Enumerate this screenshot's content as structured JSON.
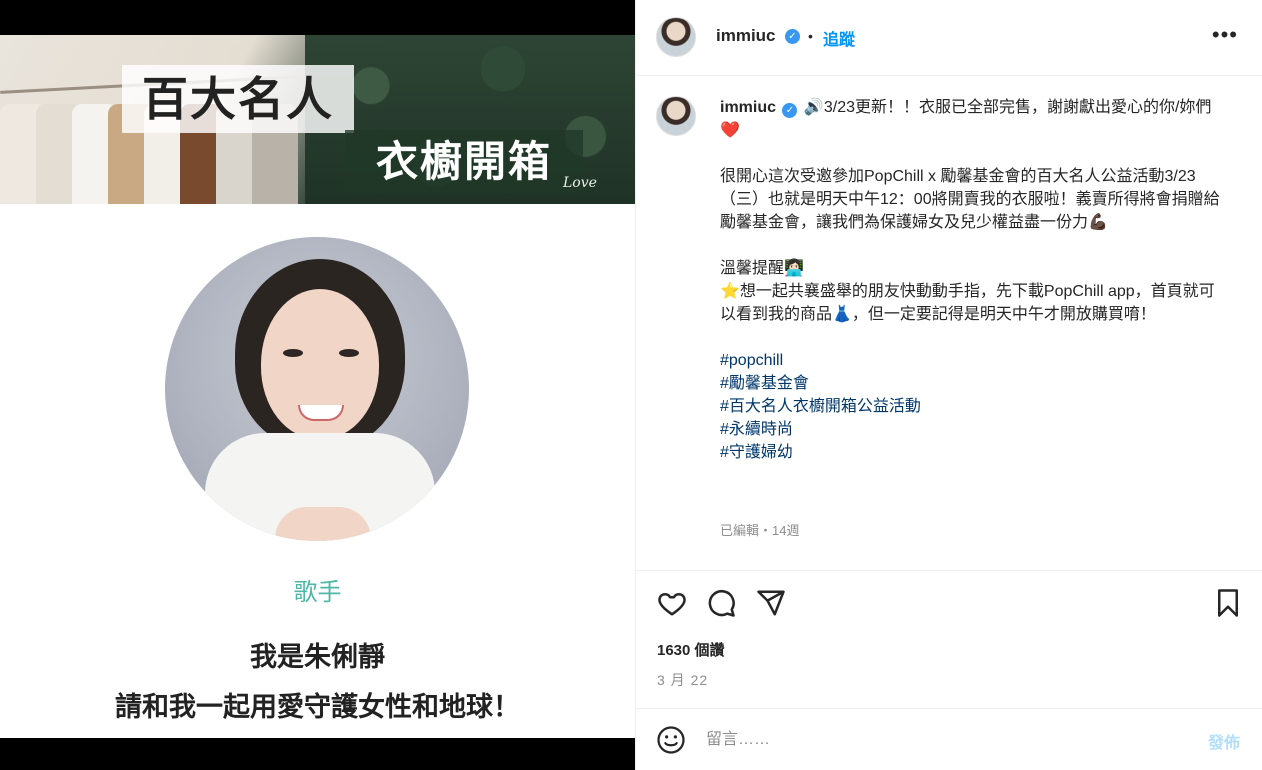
{
  "media": {
    "banner_title_1": "百大名人",
    "banner_title_2": "衣櫥開箱",
    "banner_signature": "Love",
    "role": "歌手",
    "line1": "我是朱俐靜",
    "line2": "請和我一起用愛守護女性和地球！"
  },
  "header": {
    "username": "immiuc",
    "separator": "•",
    "follow_label": "追蹤",
    "more_label": "•••"
  },
  "caption": {
    "username": "immiuc",
    "line_1": "🔊3/23更新！！衣服已全部完售，謝謝獻出愛心的你/妳們❤️",
    "paragraph_2": "很開心這次受邀參加PopChill x 勵馨基金會的百大名人公益活動3/23（三）也就是明天中午12：00將開賣我的衣服啦！義賣所得將會捐贈給勵馨基金會，讓我們為保護婦女及兒少權益盡一份力💪🏿",
    "reminder_title": "溫馨提醒👩🏻‍💻",
    "reminder_body": "⭐想一起共襄盛舉的朋友快動動手指，先下載PopChill app，首頁就可以看到我的商品👗，但一定要記得是明天中午才開放購買唷！",
    "hashtags": [
      "#popchill",
      "#勵馨基金會",
      "#百大名人衣櫥開箱公益活動",
      "#永續時尚",
      "#守護婦幼"
    ],
    "meta": "已編輯・14週"
  },
  "actions": {
    "likes": "1630 個讚",
    "date": "3 月 22"
  },
  "comment": {
    "placeholder": "留言……",
    "post_label": "發佈"
  }
}
